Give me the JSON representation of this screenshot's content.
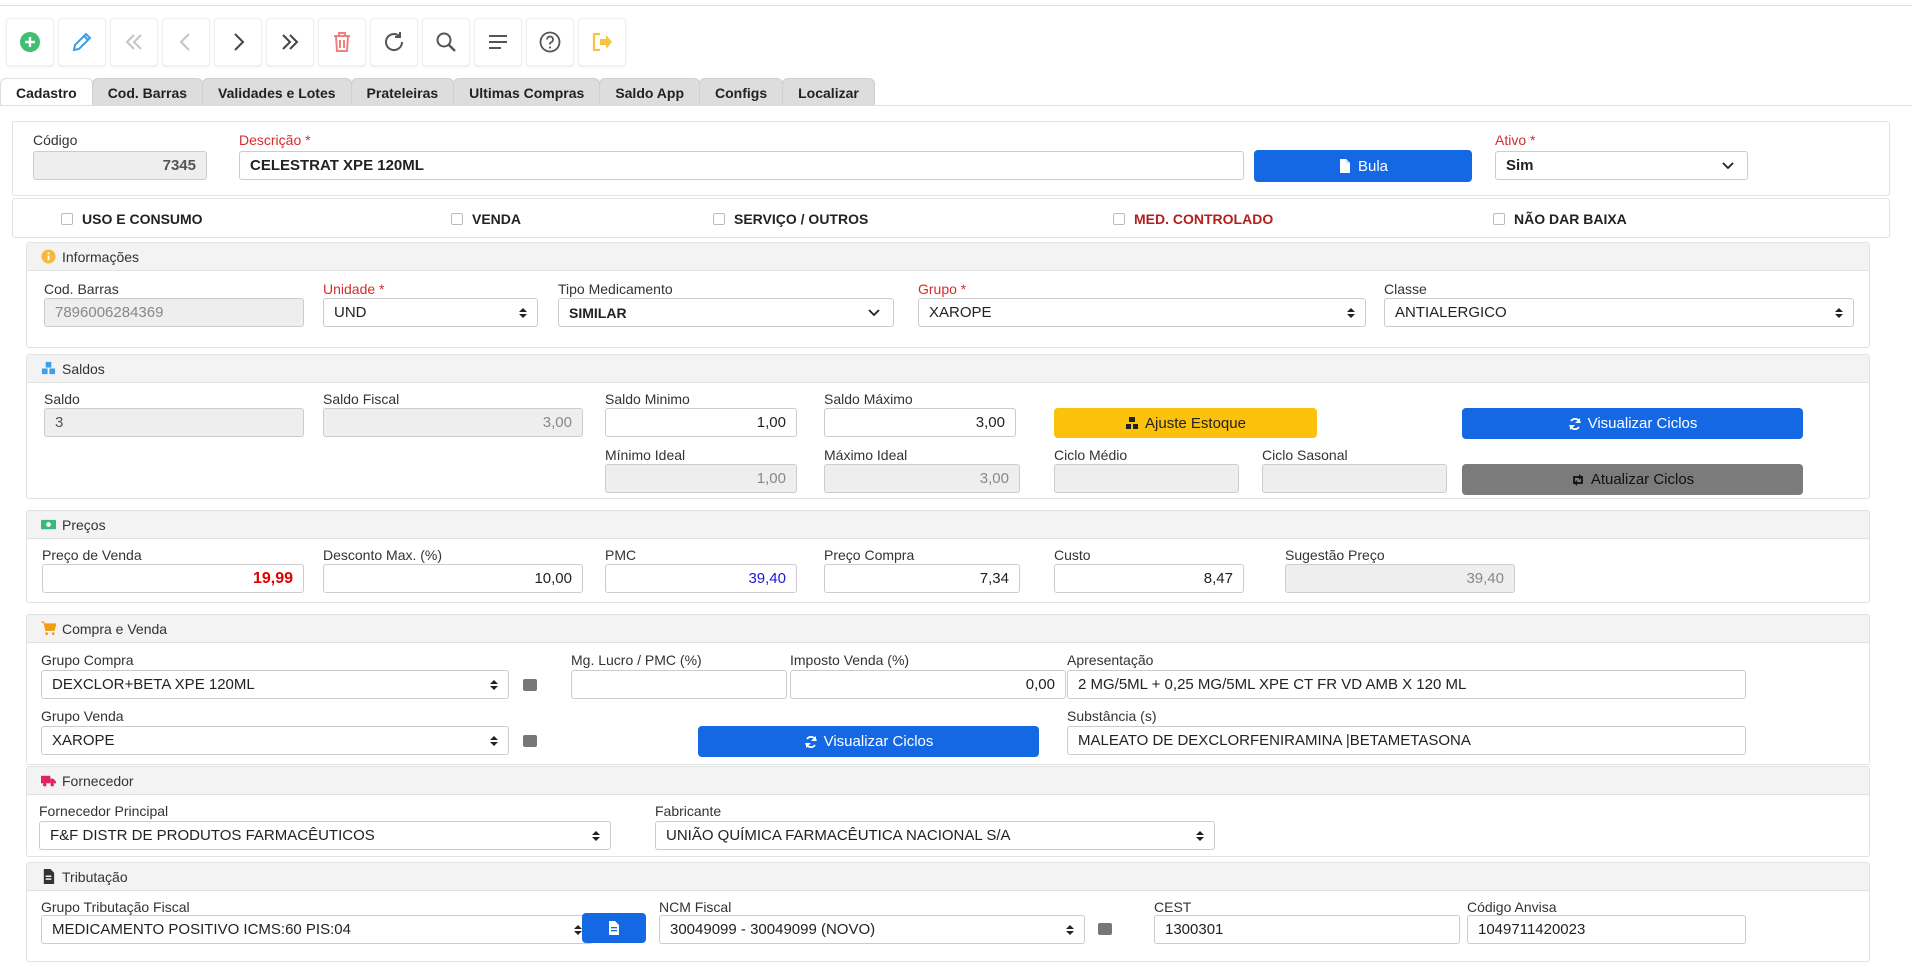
{
  "toolbar": {
    "items": [
      "add-icon",
      "edit-icon",
      "first-icon",
      "prev-icon",
      "next-icon",
      "last-icon",
      "delete-icon",
      "refresh-icon",
      "search-icon",
      "menu-icon",
      "help-icon",
      "exit-icon"
    ]
  },
  "tabs": [
    "Cadastro",
    "Cod. Barras",
    "Validades e Lotes",
    "Prateleiras",
    "Ultimas Compras",
    "Saldo App",
    "Configs",
    "Localizar"
  ],
  "header": {
    "codigo_label": "Código",
    "codigo_value": "7345",
    "descricao_label": "Descrição *",
    "descricao_value": "CELESTRAT XPE 120ML",
    "bula_label": "Bula",
    "ativo_label": "Ativo *",
    "ativo_value": "Sim"
  },
  "checkboxes": [
    "USO E CONSUMO",
    "VENDA",
    "SERVIÇO / OUTROS",
    "MED. CONTROLADO",
    "NÃO DAR BAIXA"
  ],
  "informacoes": {
    "title": "Informações",
    "cod_barras_label": "Cod. Barras",
    "cod_barras_value": "7896006284369",
    "unidade_label": "Unidade *",
    "unidade_value": "UND",
    "tipo_label": "Tipo Medicamento",
    "tipo_value": "SIMILAR",
    "grupo_label": "Grupo *",
    "grupo_value": "XAROPE",
    "classe_label": "Classe",
    "classe_value": "ANTIALERGICO"
  },
  "saldos": {
    "title": "Saldos",
    "saldo_label": "Saldo",
    "saldo_value": "3",
    "saldo_fiscal_label": "Saldo Fiscal",
    "saldo_fiscal_value": "3,00",
    "saldo_minimo_label": "Saldo Minimo",
    "saldo_minimo_value": "1,00",
    "saldo_maximo_label": "Saldo Máximo",
    "saldo_maximo_value": "3,00",
    "ajuste_label": "Ajuste Estoque",
    "visualizar_label": "Visualizar Ciclos",
    "minimo_ideal_label": "Mínimo Ideal",
    "minimo_ideal_value": "1,00",
    "maximo_ideal_label": "Máximo Ideal",
    "maximo_ideal_value": "3,00",
    "ciclo_medio_label": "Ciclo Médio",
    "ciclo_sasonal_label": "Ciclo Sasonal",
    "atualizar_label": "Atualizar Ciclos"
  },
  "precos": {
    "title": "Preços",
    "preco_venda_label": "Preço de Venda",
    "preco_venda_value": "19,99",
    "desconto_label": "Desconto Max. (%)",
    "desconto_value": "10,00",
    "pmc_label": "PMC",
    "pmc_value": "39,40",
    "preco_compra_label": "Preço Compra",
    "preco_compra_value": "7,34",
    "custo_label": "Custo",
    "custo_value": "8,47",
    "sugestao_label": "Sugestão Preço",
    "sugestao_value": "39,40"
  },
  "compra_venda": {
    "title": "Compra e Venda",
    "grupo_compra_label": "Grupo Compra",
    "grupo_compra_value": "DEXCLOR+BETA XPE 120ML",
    "mg_lucro_label": "Mg. Lucro / PMC (%)",
    "imposto_label": "Imposto Venda (%)",
    "imposto_value": "0,00",
    "apresentacao_label": "Apresentação",
    "apresentacao_value": "2 MG/5ML + 0,25 MG/5ML XPE CT FR VD AMB X 120 ML",
    "grupo_venda_label": "Grupo Venda",
    "grupo_venda_value": "XAROPE",
    "visualizar_label": "Visualizar Ciclos",
    "substancia_label": "Substância (s)",
    "substancia_value": "MALEATO DE DEXCLORFENIRAMINA |BETAMETASONA"
  },
  "fornecedor": {
    "title": "Fornecedor",
    "principal_label": "Fornecedor Principal",
    "principal_value": "F&F DISTR DE PRODUTOS FARMACÊUTICOS",
    "fabricante_label": "Fabricante",
    "fabricante_value": "UNIÃO QUÍMICA FARMACÊUTICA NACIONAL S/A"
  },
  "tributacao": {
    "title": "Tributação",
    "grupo_label": "Grupo Tributação Fiscal",
    "grupo_value": "MEDICAMENTO POSITIVO ICMS:60 PIS:04",
    "ncm_label": "NCM Fiscal",
    "ncm_value": "30049099 - 30049099 (NOVO)",
    "cest_label": "CEST",
    "cest_value": "1300301",
    "anvisa_label": "Código Anvisa",
    "anvisa_value": "1049711420023"
  },
  "colors": {
    "accent": "#1468e4",
    "warning": "#fcc10a",
    "required": "#d42c2c",
    "price_red": "#e00000",
    "pmc_blue": "#1a1ad6"
  }
}
